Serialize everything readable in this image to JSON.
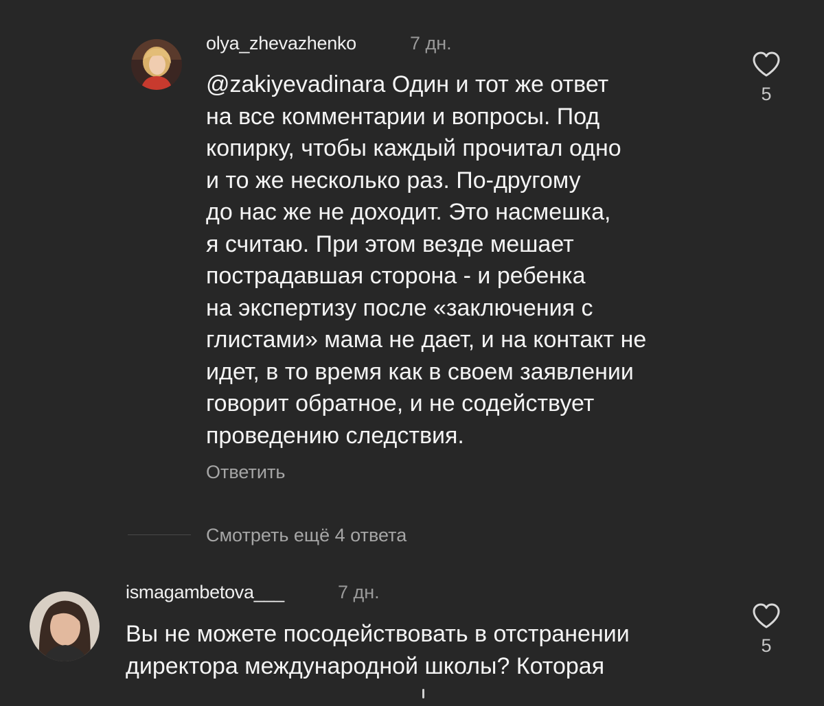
{
  "comments": [
    {
      "username": "olya_zhevazhenko",
      "time": "7 дн.",
      "mention": "@zakiyevadinara",
      "lines": [
        " Один и тот же ответ",
        "на все комментарии и вопросы. Под",
        "копирку, чтобы каждый прочитал  одно",
        "и то же несколько раз. По-другому",
        "до нас же не доходит. Это насмешка,",
        "я считаю. При этом везде мешает",
        "пострадавшая сторона - и ребенка",
        "на экспертизу после «заключения с",
        "глистами» мама не дает, и на контакт не",
        "идет, в то время как в своем заявлении",
        "говорит обратное, и не содействует",
        "проведению следствия."
      ],
      "reply_label": "Ответить",
      "likes": "5",
      "view_replies_label": "Смотреть ещё 4 ответа"
    },
    {
      "username": "ismagambetova___",
      "time": "7 дн.",
      "lines": [
        "Вы не можете посодействовать в отстранении",
        "директора международной школы? Которая"
      ],
      "likes": "5"
    }
  ],
  "icons": {
    "like": "heart-outline-icon"
  },
  "colors": {
    "background": "#272727",
    "text": "#f4f4f4",
    "secondary_text": "#a6a6a6"
  }
}
